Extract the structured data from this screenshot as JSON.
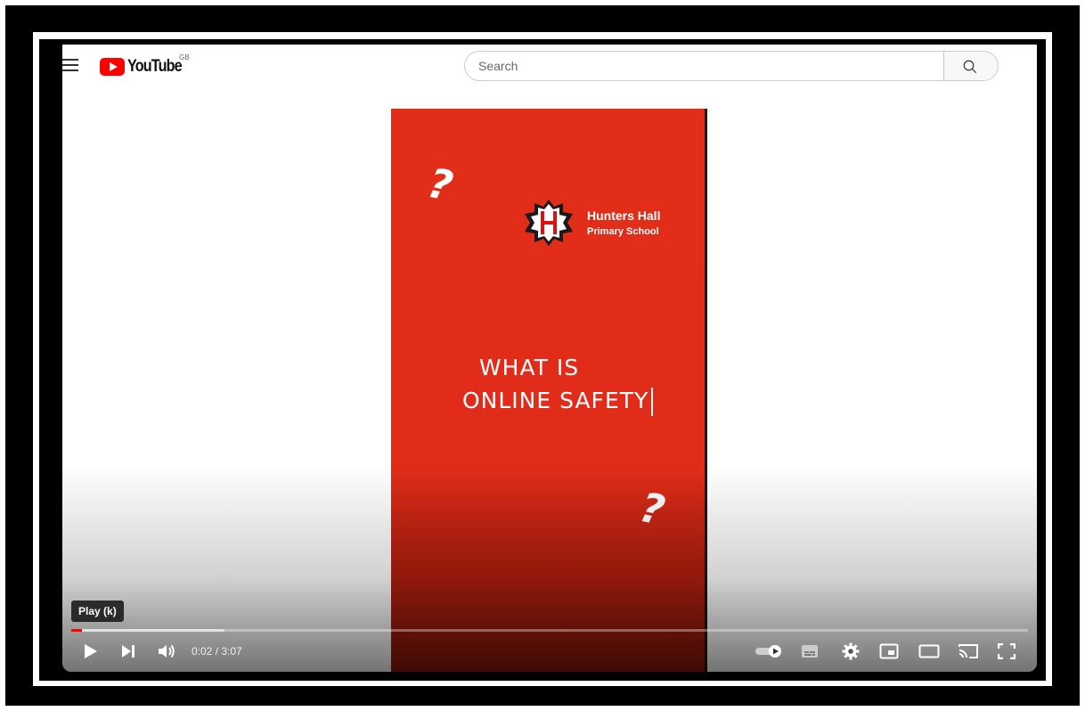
{
  "header": {
    "logo_text": "YouTube",
    "country_code": "GB",
    "search_placeholder": "Search"
  },
  "video": {
    "school_name": "Hunters Hall",
    "school_subtitle": "Primary School",
    "headline_line1": "WHAT IS",
    "headline_line2": "ONLINE SAFETY",
    "question_mark": "?"
  },
  "player": {
    "tooltip": "Play (k)",
    "current_time": "0:02",
    "separator": " / ",
    "duration": "3:07",
    "progress_played_fraction": 0.011,
    "progress_buffered_fraction": 0.16,
    "accent_color": "#ff0000"
  }
}
